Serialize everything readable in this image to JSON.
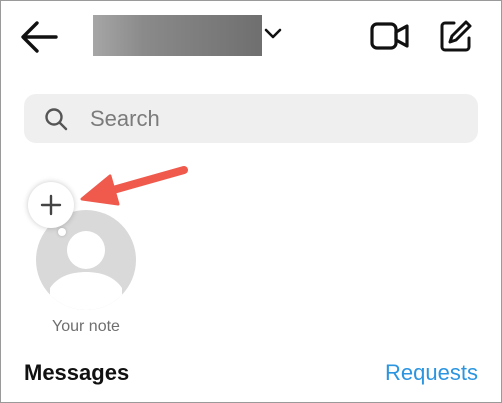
{
  "header": {
    "back_icon": "back-arrow-icon",
    "username_redacted": true,
    "account_switch_icon": "chevron-down-icon",
    "video_icon": "video-camera-icon",
    "compose_icon": "compose-icon"
  },
  "search": {
    "placeholder": "Search",
    "icon": "search-icon"
  },
  "notes": {
    "add_icon": "plus-icon",
    "your_note_label": "Your note",
    "annotation": "red-arrow-icon",
    "annotation_color": "#ef5a4c"
  },
  "inbox": {
    "messages_title": "Messages",
    "requests_label": "Requests"
  },
  "colors": {
    "link": "#2b95e0",
    "search_bg": "#efefef",
    "avatar_bg": "#d9d9d9"
  }
}
